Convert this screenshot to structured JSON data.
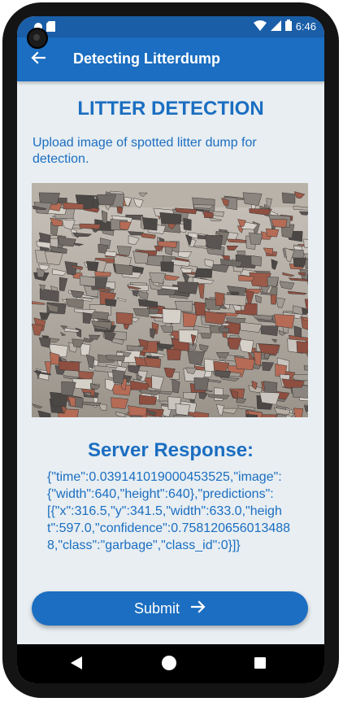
{
  "status": {
    "time": "6:46",
    "icons": [
      "record-icon",
      "sd-card-icon",
      "wifi-icon",
      "signal-icon",
      "battery-icon"
    ]
  },
  "app_bar": {
    "title": "Detecting Litterdump",
    "back_icon": "arrow-left-icon"
  },
  "main": {
    "heading": "LITTER DETECTION",
    "subtitle": "Upload image of spotted litter dump for detection.",
    "image_subject": "litter-dump-photo",
    "response_title": "Server Response:",
    "response_body": "{\"time\":0.039141019000453525,\"image\":{\"width\":640,\"height\":640},\"predictions\":[{\"x\":316.5,\"y\":341.5,\"width\":633.0,\"height\":597.0,\"confidence\":0.7581206560134888,\"class\":\"garbage\",\"class_id\":0}]}",
    "submit_label": "Submit",
    "submit_icon": "arrow-right-icon"
  },
  "colors": {
    "primary": "#1b6ec1",
    "status_bar": "#1a5ea8",
    "background": "#e8eef2"
  },
  "nav": {
    "icons": [
      "nav-back-icon",
      "nav-home-icon",
      "nav-recent-icon"
    ]
  }
}
